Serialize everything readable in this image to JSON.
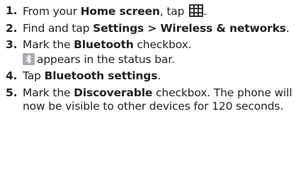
{
  "steps": [
    {
      "number": "1.",
      "before": "From your ",
      "bold1": "Home screen",
      "after": ", tap ",
      "icon": "app-grid-icon",
      "end": "."
    },
    {
      "number": "2.",
      "before": "Find and tap ",
      "bold1": "Settings > Wireless & networks",
      "end": "."
    },
    {
      "number": "3.",
      "before": "Mark the ",
      "bold1": "Bluetooth",
      "after": " checkbox.",
      "line2_icon": "bluetooth-status-icon",
      "line2_text": "appears in the status bar."
    },
    {
      "number": "4.",
      "before": "Tap ",
      "bold1": "Bluetooth settings",
      "end": "."
    },
    {
      "number": "5.",
      "before": "Mark the ",
      "bold1": "Discoverable",
      "after": " checkbox. The phone will now be visible to other devices for 120 seconds."
    }
  ],
  "colors": {
    "text": "#231f20",
    "bluetooth_badge": "#a9adb2",
    "bluetooth_symbol": "#ffffff"
  }
}
